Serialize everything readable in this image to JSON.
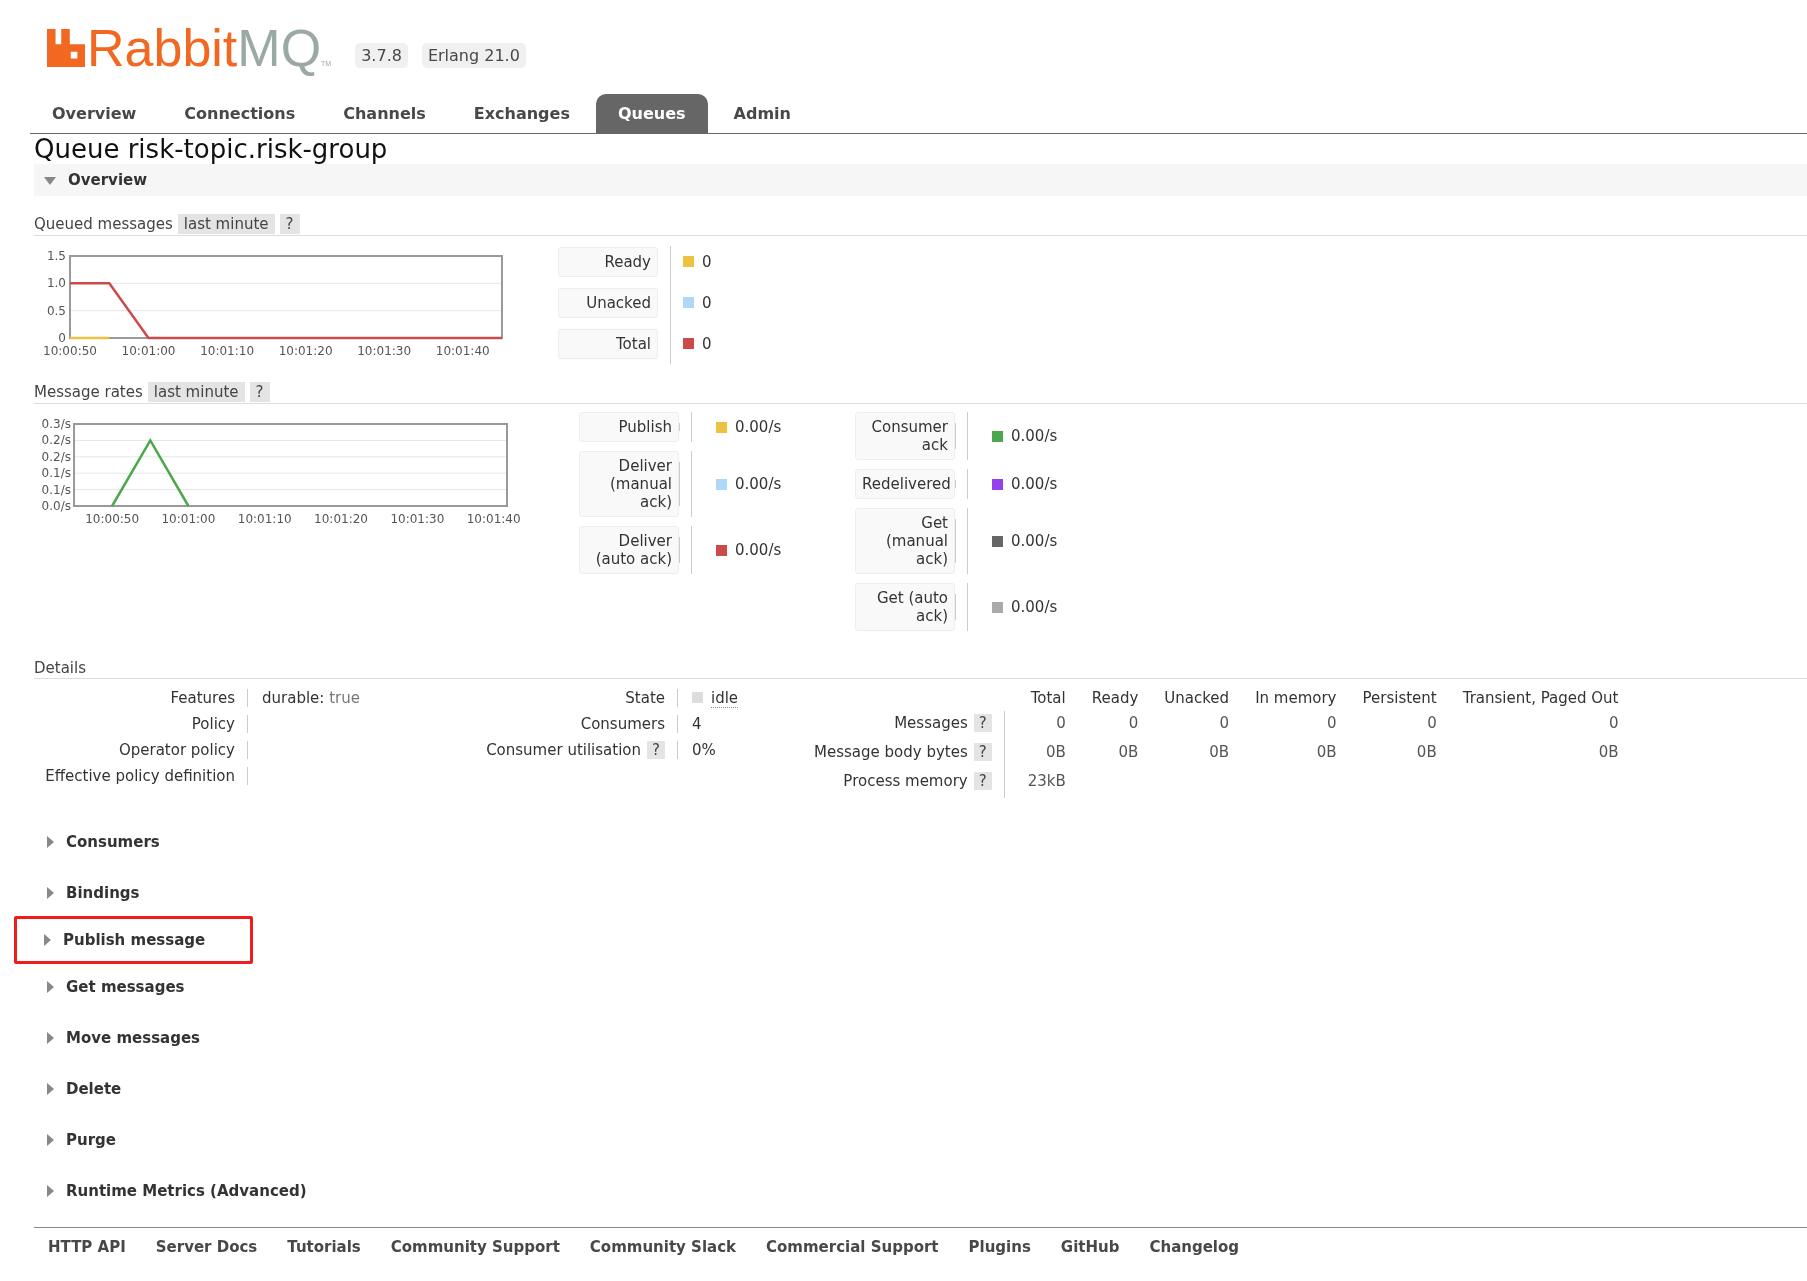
{
  "header": {
    "logo_parts": [
      "Rabbit",
      "MQ",
      "TM"
    ],
    "version": "3.7.8",
    "erlang": "Erlang 21.0"
  },
  "nav": [
    {
      "label": "Overview",
      "selected": false
    },
    {
      "label": "Connections",
      "selected": false
    },
    {
      "label": "Channels",
      "selected": false
    },
    {
      "label": "Exchanges",
      "selected": false
    },
    {
      "label": "Queues",
      "selected": true
    },
    {
      "label": "Admin",
      "selected": false
    }
  ],
  "page_title": "Queue risk-topic.risk-group",
  "overview": {
    "title": "Overview",
    "expanded": true
  },
  "queued_messages": {
    "title": "Queued messages",
    "range": "last minute",
    "help": "?",
    "readings": [
      "0",
      "0",
      "0"
    ],
    "chart_data": {
      "type": "line",
      "categories": [
        "10:00:50",
        null,
        "10:01:00",
        null,
        "10:01:10",
        null,
        "10:01:20",
        null,
        "10:01:30",
        null,
        "10:01:40",
        null
      ],
      "ylim": [
        0,
        1.5
      ],
      "yticks": [
        0,
        0.5,
        {
          "value": 1,
          "label": "1.0"
        },
        1.5
      ],
      "grid": true,
      "series": [
        {
          "name": "Ready",
          "color": "#edc240",
          "values": [
            0,
            0,
            null,
            null,
            null,
            null,
            null,
            null,
            null,
            null,
            null,
            null
          ]
        },
        {
          "name": "Unacked",
          "color": "#afd8f8",
          "values": [
            null,
            null,
            null,
            null,
            null,
            null,
            null,
            null,
            null,
            null,
            null,
            null
          ]
        },
        {
          "name": "Total",
          "color": "#cb4b4b",
          "values": [
            1,
            1,
            0,
            0,
            0,
            0,
            0,
            0,
            0,
            0,
            0,
            0
          ]
        }
      ]
    }
  },
  "message_rates": {
    "title": "Message rates",
    "range": "last minute",
    "help": "?",
    "readings": [
      "0.00/s",
      "0.00/s",
      "0.00/s",
      "0.00/s",
      "0.00/s",
      "0.00/s",
      "0.00/s"
    ],
    "chart_data": {
      "type": "line",
      "categories": [
        null,
        "10:00:50",
        null,
        "10:01:00",
        null,
        "10:01:10",
        null,
        "10:01:20",
        null,
        "10:01:30",
        null,
        "10:01:40"
      ],
      "ylim": [
        0,
        0.25
      ],
      "yticks": [
        {
          "value": 0,
          "label": "0.0/s"
        },
        {
          "value": 0.05,
          "label": "0.1/s"
        },
        {
          "value": 0.1,
          "label": "0.1/s"
        },
        {
          "value": 0.15,
          "label": "0.2/s"
        },
        {
          "value": 0.2,
          "label": "0.2/s"
        },
        {
          "value": 0.25,
          "label": "0.3/s"
        }
      ],
      "grid": true,
      "series": [
        {
          "name": "Publish",
          "color": "#edc240",
          "values": [
            null,
            null,
            null,
            null,
            null,
            null,
            null,
            null,
            null,
            null,
            null,
            null
          ]
        },
        {
          "name": "Deliver (manual ack)",
          "color": "#afd8f8",
          "values": [
            null,
            null,
            null,
            null,
            null,
            null,
            null,
            null,
            null,
            null,
            null,
            null
          ]
        },
        {
          "name": "Deliver (auto ack)",
          "color": "#cb4b4b",
          "values": [
            null,
            null,
            null,
            null,
            null,
            null,
            null,
            null,
            null,
            null,
            null,
            null
          ]
        },
        {
          "name": "Consumer ack",
          "color": "#4da74d",
          "values": [
            null,
            0,
            0.2,
            0,
            null,
            null,
            null,
            null,
            null,
            null,
            null,
            null
          ]
        },
        {
          "name": "Redelivered",
          "color": "#9440ed",
          "values": [
            null,
            null,
            null,
            null,
            null,
            null,
            null,
            null,
            null,
            null,
            null,
            null
          ]
        },
        {
          "name": "Get (manual ack)",
          "color": "#666666",
          "values": [
            null,
            null,
            null,
            null,
            null,
            null,
            null,
            null,
            null,
            null,
            null,
            null
          ]
        },
        {
          "name": "Get (auto ack)",
          "color": "#aaaaaa",
          "values": [
            null,
            null,
            null,
            null,
            null,
            null,
            null,
            null,
            null,
            null,
            null,
            null
          ]
        }
      ]
    }
  },
  "details": {
    "title": "Details",
    "properties": [
      {
        "label": "Features",
        "key": "durable:",
        "value": "true"
      },
      {
        "label": "Policy"
      },
      {
        "label": "Operator policy"
      },
      {
        "label": "Effective policy definition"
      }
    ],
    "status": [
      {
        "label": "State",
        "value": "idle",
        "kind": "state"
      },
      {
        "label": "Consumers",
        "value": "4"
      },
      {
        "label": "Consumer utilisation",
        "help": "?",
        "value": "0%"
      }
    ],
    "table": {
      "columns": [
        "Total",
        "Ready",
        "Unacked",
        "In memory",
        "Persistent",
        "Transient, Paged Out"
      ],
      "rows": [
        {
          "label": "Messages",
          "help": "?",
          "cells": [
            "0",
            "0",
            "0",
            "0",
            "0",
            "0"
          ]
        },
        {
          "label": "Message body bytes",
          "help": "?",
          "cells": [
            "0B",
            "0B",
            "0B",
            "0B",
            "0B",
            "0B"
          ]
        },
        {
          "label": "Process memory",
          "help": "?",
          "cells": [
            "23kB"
          ]
        }
      ]
    }
  },
  "sections": [
    {
      "title": "Consumers",
      "expanded": false,
      "highlighted": false
    },
    {
      "title": "Bindings",
      "expanded": false,
      "highlighted": false
    },
    {
      "title": "Publish message",
      "expanded": false,
      "highlighted": true
    },
    {
      "title": "Get messages",
      "expanded": false,
      "highlighted": false
    },
    {
      "title": "Move messages",
      "expanded": false,
      "highlighted": false
    },
    {
      "title": "Delete",
      "expanded": false,
      "highlighted": false
    },
    {
      "title": "Purge",
      "expanded": false,
      "highlighted": false
    },
    {
      "title": "Runtime Metrics (Advanced)",
      "expanded": false,
      "highlighted": false
    }
  ],
  "footer": [
    "HTTP API",
    "Server Docs",
    "Tutorials",
    "Community Support",
    "Community Slack",
    "Commercial Support",
    "Plugins",
    "GitHub",
    "Changelog"
  ]
}
